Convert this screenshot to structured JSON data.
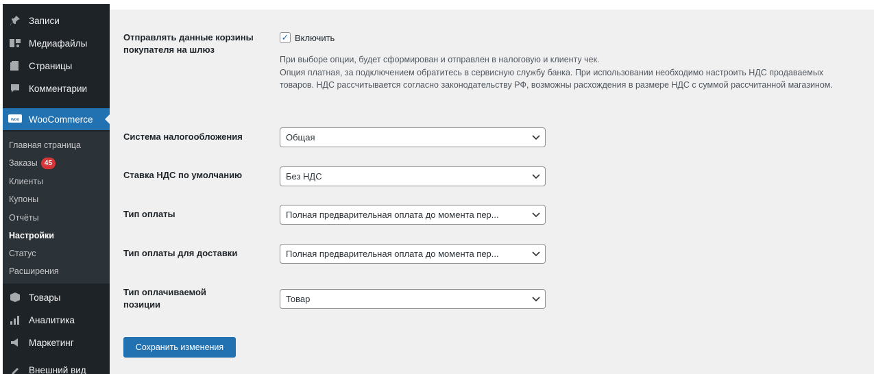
{
  "sidebar": {
    "items": [
      {
        "label": "Записи",
        "icon": "pin-icon"
      },
      {
        "label": "Медиафайлы",
        "icon": "media-icon"
      },
      {
        "label": "Страницы",
        "icon": "pages-icon"
      },
      {
        "label": "Комментарии",
        "icon": "comments-icon"
      },
      {
        "label": "WooCommerce",
        "icon": "woocommerce-icon"
      }
    ],
    "submenu": [
      {
        "label": "Главная страница"
      },
      {
        "label": "Заказы",
        "badge": "45"
      },
      {
        "label": "Клиенты"
      },
      {
        "label": "Купоны"
      },
      {
        "label": "Отчёты"
      },
      {
        "label": "Настройки"
      },
      {
        "label": "Статус"
      },
      {
        "label": "Расширения"
      }
    ],
    "items_after": [
      {
        "label": "Товары",
        "icon": "products-icon"
      },
      {
        "label": "Аналитика",
        "icon": "analytics-icon"
      },
      {
        "label": "Маркетинг",
        "icon": "marketing-icon"
      },
      {
        "label": "Внешний вид",
        "icon": "appearance-icon"
      }
    ]
  },
  "settings": {
    "send_cart": {
      "label": "Отправлять данные корзины покупателя на шлюз",
      "checkbox_label": "Включить",
      "checked": true,
      "description": "При выборе опции, будет сформирован и отправлен в налоговую и клиенту чек.\nОпция платная, за подключением обратитесь в сервисную службу банка. При использовании необходимо настроить НДС продаваемых товаров. НДС рассчитывается согласно законодательству РФ, возможны расхождения в размере НДС с суммой рассчитанной магазином."
    },
    "tax_system": {
      "label": "Система налогообложения",
      "value": "Общая"
    },
    "vat_rate": {
      "label": "Ставка НДС по умолчанию",
      "value": "Без НДС"
    },
    "payment_type": {
      "label": "Тип оплаты",
      "value": "Полная предварительная оплата до момента пер..."
    },
    "delivery_payment_type": {
      "label": "Тип оплаты для доставки",
      "value": "Полная предварительная оплата до момента пер..."
    },
    "item_type": {
      "label": "Тип оплачиваемой позиции",
      "value": "Товар"
    }
  },
  "save_button": {
    "label": "Сохранить изменения"
  },
  "colors": {
    "accent": "#2271b1",
    "sidebar": "#1d2327",
    "badge": "#d63638"
  }
}
